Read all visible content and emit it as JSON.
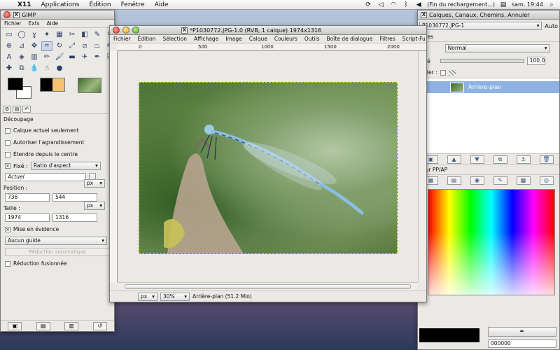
{
  "menubar": {
    "app": "X11",
    "items": [
      "Applications",
      "Édition",
      "Fenêtre",
      "Aide"
    ],
    "status": "(Fin du rechargement...)",
    "clock": "sam. 19:44"
  },
  "toolbox": {
    "title": "GIMP",
    "menu": [
      "Fichier",
      "Exts",
      "Aide"
    ],
    "tool_options_title": "Découpage",
    "opt_current_layer": "Calque actuel seulement",
    "opt_allow_grow": "Autoriser l'agrandissement",
    "opt_expand_center": "Étendre depuis le centre",
    "fixed_label": "Fixé :",
    "fixed_mode": "Ratio d'aspect",
    "actuel": "Actuel",
    "position_label": "Position :",
    "position_unit": "px",
    "pos_x": "736",
    "pos_y": "544",
    "size_label": "Taille :",
    "size_unit": "px",
    "size_w": "1974",
    "size_h": "1316",
    "highlight": "Mise en évidence",
    "guides": "Aucun guide",
    "auto_shrink": "Réduction automatique",
    "merged_shrink": "Réduction fusionnée"
  },
  "image_window": {
    "title": "*P1030772.JPG-1.0 (RVB, 1 calque) 1974x1316",
    "menu": [
      "Fichier",
      "Édition",
      "Sélection",
      "Affichage",
      "Image",
      "Calque",
      "Couleurs",
      "Outils",
      "Boîte de dialogue",
      "Filtres",
      "Script-Fu"
    ],
    "ruler_ticks": [
      "0",
      "500",
      "1000",
      "1500",
      "2000"
    ],
    "unit": "px",
    "zoom": "30%",
    "status": "Arrière-plan (51.2 Mio)"
  },
  "layers_dock": {
    "title": "Calques, Canaux, Chemins, Annuler",
    "auto_label": "Auto",
    "image_select": "P1030772.JPG-1",
    "tab_label": "ques",
    "mode_label": "e",
    "mode": "Normal",
    "opacity_label": "cité",
    "opacity": "100.0",
    "lock_label": "uiller :",
    "layer_name": "Arrière-plan",
    "fgbg_label": "leur PP/AP",
    "hex": "000000"
  }
}
